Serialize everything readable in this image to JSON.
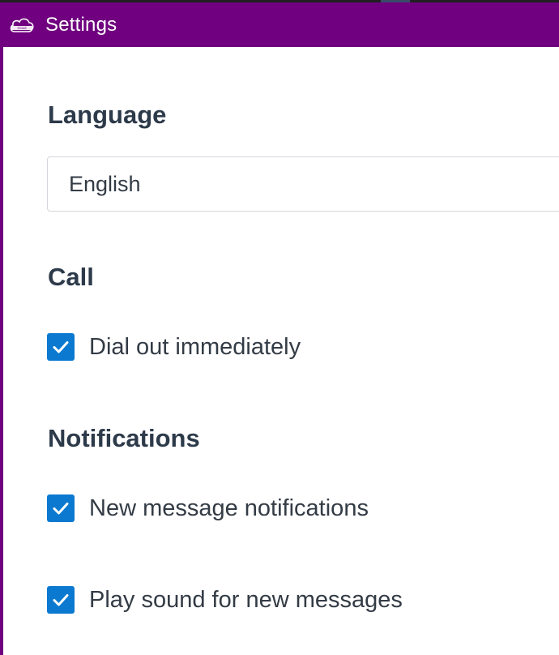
{
  "window": {
    "title": "Settings",
    "logo_icon": "cloud-logo-icon",
    "accent_color": "#70007f"
  },
  "language": {
    "heading": "Language",
    "selected": "English"
  },
  "call": {
    "heading": "Call",
    "options": [
      {
        "label": "Dial out immediately",
        "checked": true
      }
    ]
  },
  "notifications": {
    "heading": "Notifications",
    "options": [
      {
        "label": "New message notifications",
        "checked": true
      },
      {
        "label": "Play sound for new messages",
        "checked": true
      }
    ]
  },
  "colors": {
    "checkbox": "#0b79d0",
    "heading_text": "#2d3a4a",
    "body_text": "#333b45"
  }
}
